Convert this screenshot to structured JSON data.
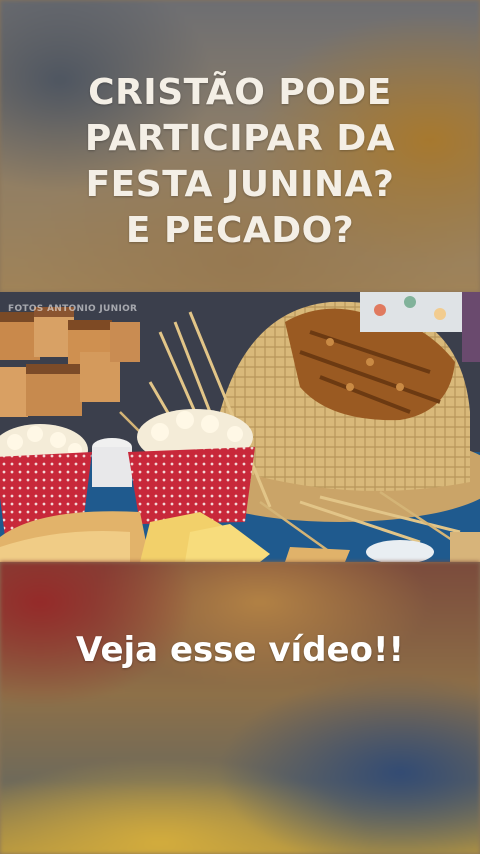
{
  "title": "CRISTÃO PODE\nPARTICIPAR DA\nFESTA  JUNINA?\nE PECADO?",
  "photo": {
    "watermark": "FOTOS ANTONIO JUNIOR",
    "subject": "festa-junina-food-table"
  },
  "cta": "Veja esse vídeo!!",
  "colors": {
    "text": "#ffffff",
    "popcorn_box": "#c8283a",
    "straw_hat": "#d9b97a"
  }
}
